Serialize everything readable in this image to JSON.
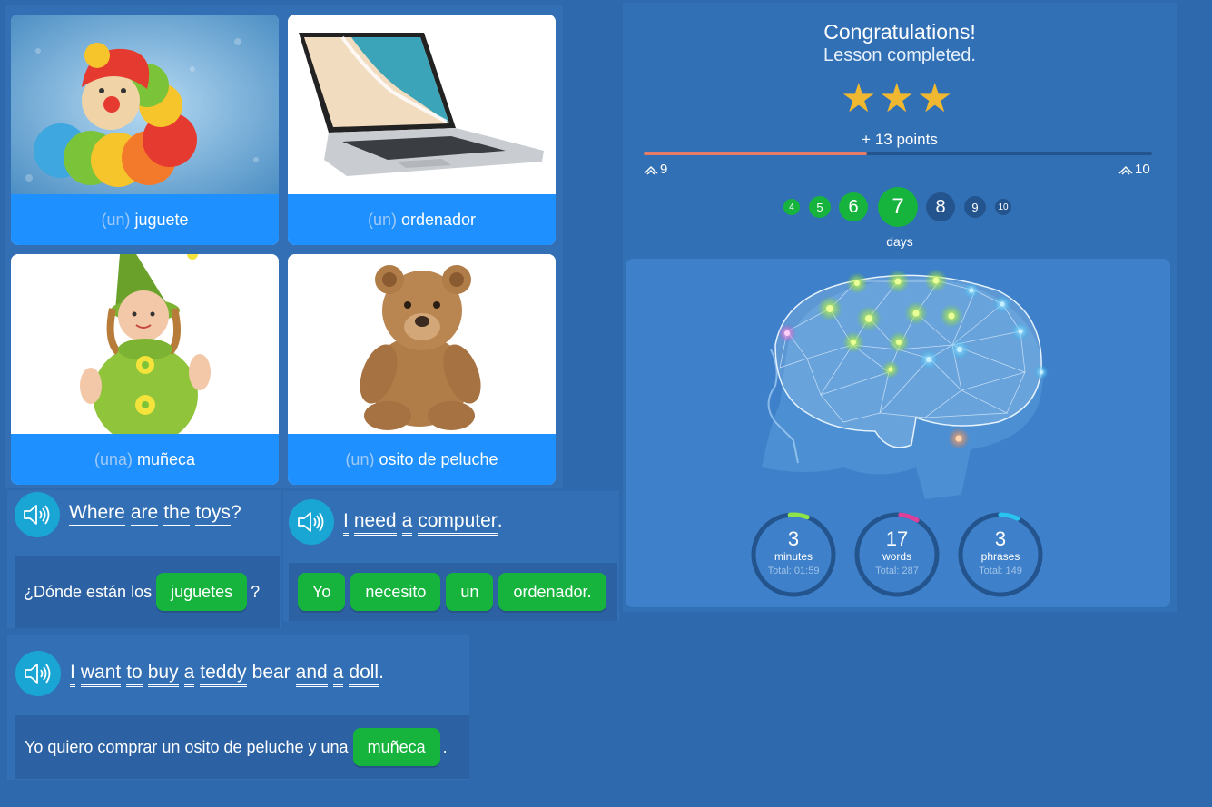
{
  "cards": [
    {
      "article": "(un)",
      "word": "juguete",
      "picture": "toy-caterpillar"
    },
    {
      "article": "(un)",
      "word": "ordenador",
      "picture": "laptop"
    },
    {
      "article": "(una)",
      "word": "muñeca",
      "picture": "doll"
    },
    {
      "article": "(un)",
      "word": "osito de peluche",
      "picture": "teddy-bear"
    }
  ],
  "sentences": [
    {
      "english_words": [
        "Where",
        "are",
        "the",
        "toys"
      ],
      "english_end": "?",
      "spanish_prefix": "¿Dónde están los",
      "answer_chip": "juguetes",
      "spanish_end": "?"
    },
    {
      "english_words": [
        "I",
        "need",
        "a",
        "computer"
      ],
      "english_end": ".",
      "chips": [
        "Yo",
        "necesito",
        "un",
        "ordenador."
      ]
    },
    {
      "english_words": [
        "I",
        "want",
        "to",
        "buy",
        "a",
        "teddy",
        "bear",
        "and",
        "a",
        "doll"
      ],
      "english_end": ".",
      "spanish_prefix": "Yo quiero comprar un osito de peluche y una",
      "answer_chip": "muñeca",
      "spanish_end": "."
    }
  ],
  "result": {
    "title": "Congratulations!",
    "subtitle": "Lesson completed.",
    "stars": 3,
    "points": "+ 13 points",
    "level_progress": 0.44,
    "level_current": "9",
    "level_next": "10",
    "days": [
      "4",
      "5",
      "6",
      "7",
      "8",
      "9",
      "10"
    ],
    "current_day": "7",
    "days_label": "days",
    "stats": [
      {
        "value": "3",
        "label": "minutes",
        "total": "Total: 01:59",
        "color": "#8fe34a"
      },
      {
        "value": "17",
        "label": "words",
        "total": "Total: 287",
        "color": "#e0409a"
      },
      {
        "value": "3",
        "label": "phrases",
        "total": "Total: 149",
        "color": "#29c3f0"
      }
    ]
  },
  "colors": {
    "background": "#2f69ad",
    "card_caption": "#1e90ff",
    "chip": "#16b33d",
    "speaker": "#1aa6d5",
    "star": "#f0b731",
    "progress": "#e57b69"
  }
}
